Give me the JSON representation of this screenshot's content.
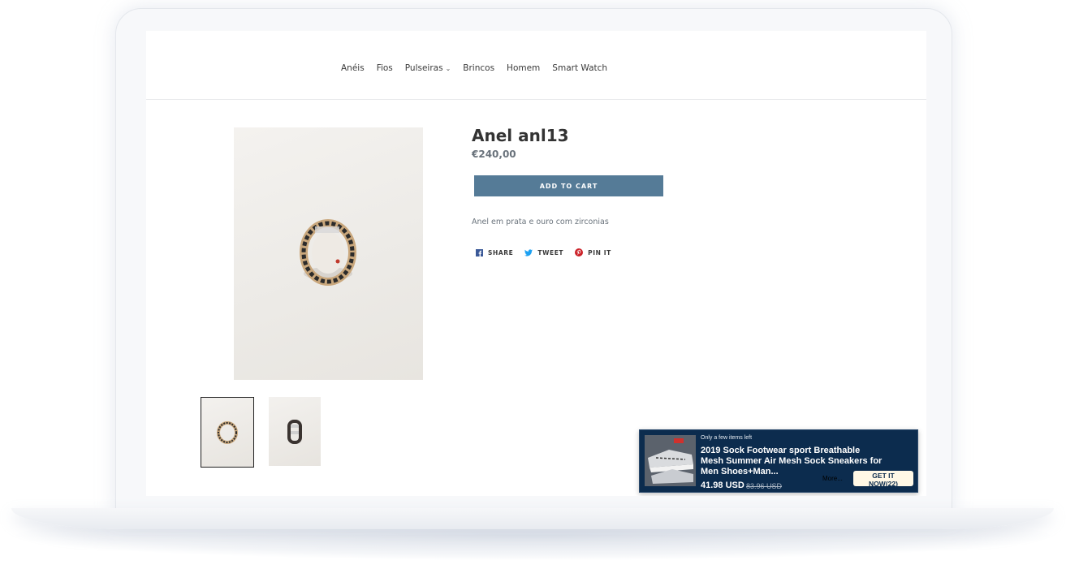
{
  "nav": {
    "items": [
      {
        "label": "Anéis"
      },
      {
        "label": "Fios"
      },
      {
        "label": "Pulseiras",
        "chevron": "⌄"
      },
      {
        "label": "Brincos"
      },
      {
        "label": "Homem"
      },
      {
        "label": "Smart Watch"
      }
    ]
  },
  "product": {
    "title": "Anel anl13",
    "price": "€240,00",
    "add_to_cart": "ADD TO CART",
    "description": "Anel em prata e ouro com zirconias",
    "accent_color": "#557b97"
  },
  "social": {
    "share": "SHARE",
    "tweet": "TWEET",
    "pin": "PIN IT",
    "share_icon": "facebook-icon",
    "tweet_icon": "twitter-icon",
    "pin_icon": "pinterest-icon"
  },
  "ad": {
    "badge": "Only a few items left",
    "title": "2019 Sock Footwear sport Breathable Mesh Summer Air Mesh Sock Sneakers for Men Shoes+Man...",
    "price": "41.98 USD",
    "old_price": "83.96 USD",
    "more": "More...",
    "cta": "GET IT NOW(22)",
    "background_color": "#0c2c4e"
  }
}
